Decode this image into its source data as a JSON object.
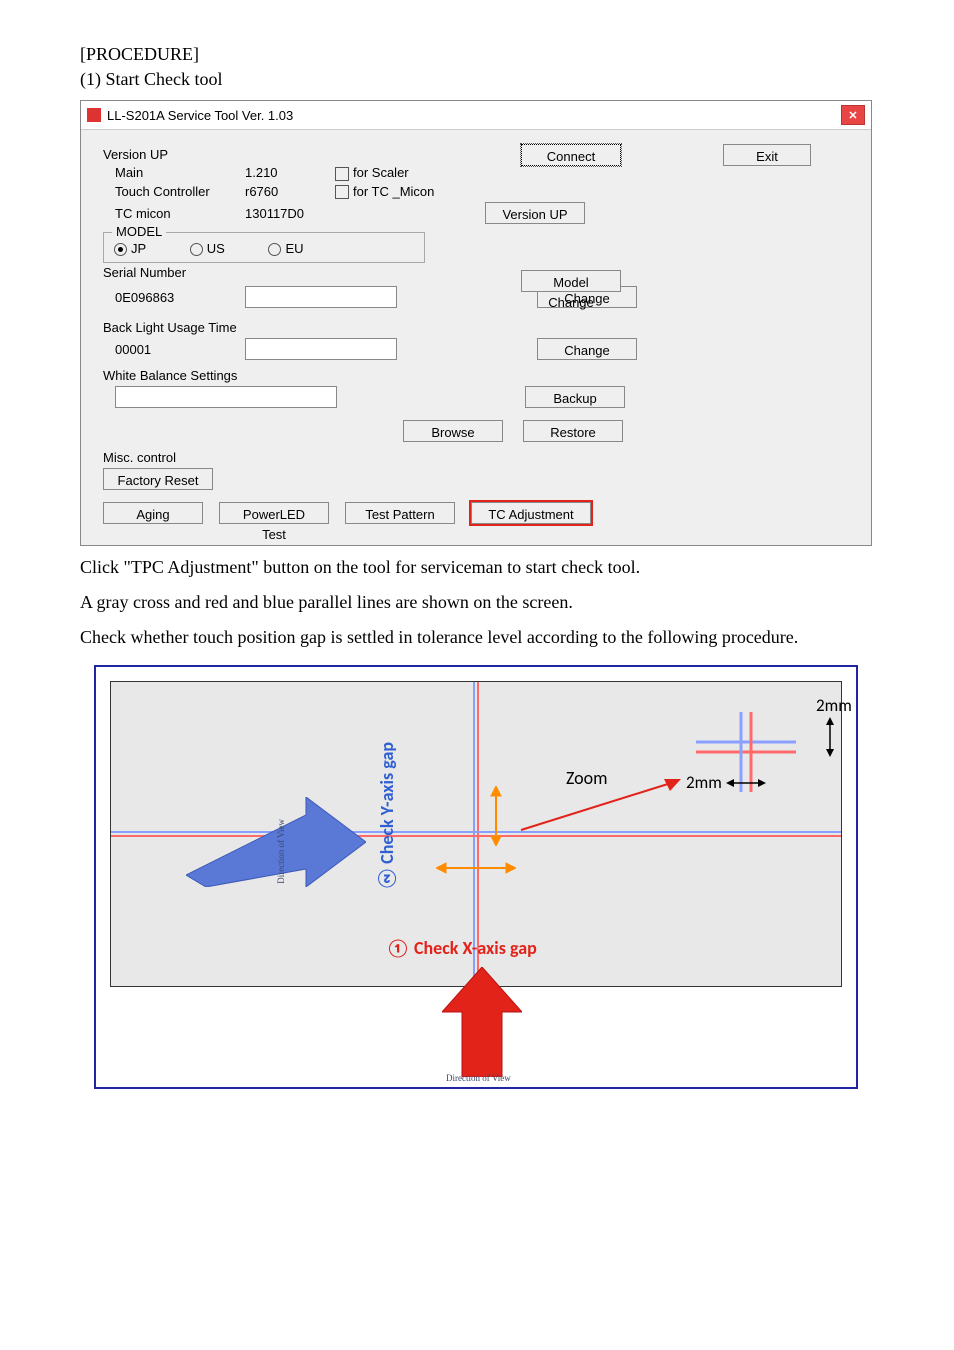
{
  "doc": {
    "heading": "[PROCEDURE]",
    "step1": "(1) Start Check tool",
    "instr1": "Click \"TPC Adjustment\" button on the tool for serviceman to start check tool.",
    "instr2": "A gray cross and red and blue parallel lines are shown on the screen.",
    "instr3": "Check whether touch position gap is settled in tolerance level according to the following procedure."
  },
  "app": {
    "title": "LL-S201A Service Tool  Ver. 1.03",
    "version_up_label": "Version UP",
    "main_label": "Main",
    "main_value": "1.210",
    "tc_label": "Touch Controller",
    "tc_value": "r6760",
    "tc_micon_label": "TC micon",
    "tc_micon_value": "130117D0",
    "chk_scaler": "for Scaler",
    "chk_tcmicon": "for TC _Micon",
    "model_group": "MODEL",
    "model_jp": "JP",
    "model_us": "US",
    "model_eu": "EU",
    "serial_group": "Serial Number",
    "serial_value": "0E096863",
    "backlight_label": "Back Light Usage Time",
    "backlight_value": "00001",
    "wb_label": "White Balance Settings",
    "misc_label": "Misc. control",
    "buttons": {
      "connect": "Connect",
      "exit": "Exit",
      "version_up": "Version UP",
      "model_change": "Model Change",
      "change1": "Change",
      "change2": "Change",
      "backup": "Backup",
      "browse": "Browse",
      "restore": "Restore",
      "factory_reset": "Factory Reset",
      "aging": "Aging",
      "powerled": "PowerLED Test",
      "testpattern": "Test Pattern",
      "tcadjust": "TC Adjustment"
    }
  },
  "diagram": {
    "zoom": "Zoom",
    "mm": "2mm",
    "check_x": "① Check X-axis gap",
    "check_y": "② Check Y-axis gap",
    "dov": "Direction of View"
  }
}
